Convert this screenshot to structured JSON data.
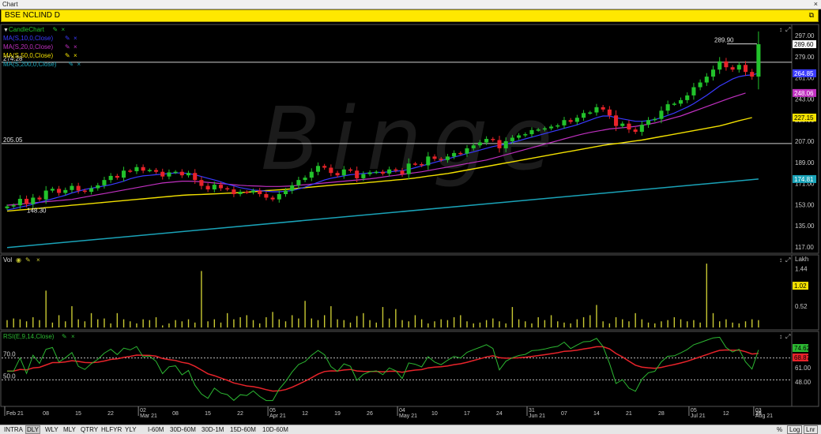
{
  "window": {
    "title": "Chart",
    "close_label": "×"
  },
  "symbol_bar": {
    "symbol": "BSE NCLIND D"
  },
  "watermark": "Binge",
  "legend": {
    "candle": "CandleChart",
    "ma5": "MA(S,10,0,Close)",
    "ma20": "MA(S,20,0,Close)",
    "ma50": "MA(S,50,0,Close)",
    "ma200": "MA(S,200,0,Close)",
    "vol": "Vol",
    "rsi": "RSI(E,9,14,Close)",
    "volume_unit": "Lakh"
  },
  "colors": {
    "up": "#22c22b",
    "down": "#e8232a",
    "ma10": "#3a3aff",
    "ma20": "#c030c0",
    "ma50": "#f2e000",
    "ma200": "#1aa3b8",
    "volume": "#c8c832",
    "rsi_line": "#2cb832",
    "rsi_signal": "#e8232a"
  },
  "bottom_bar": {
    "periods": [
      "INTRA",
      "DLY",
      "WLY",
      "MLY",
      "QTRY",
      "HLFYR",
      "YLY",
      "I-60M",
      "30D-60M",
      "30D-1M",
      "15D-60M",
      "10D-60M"
    ],
    "active_period": "DLY",
    "percent": "%",
    "log": "Log",
    "linear": "Lnr"
  },
  "chart_data": [
    {
      "type": "candlestick",
      "title": "BSE NCLIND D",
      "ylim": [
        117,
        297
      ],
      "y_ticks": [
        "297.00",
        "279.00",
        "261.00",
        "243.00",
        "225.00",
        "207.00",
        "189.00",
        "171.00",
        "153.00",
        "135.00",
        "117.00"
      ],
      "x_ticks": [
        "Feb 21",
        "08",
        "15",
        "22",
        "Mar 21",
        "08",
        "15",
        "22",
        "Apr 21",
        "12",
        "19",
        "26",
        "May 21",
        "10",
        "17",
        "24",
        "Jun 21",
        "07",
        "14",
        "21",
        "28",
        "Jul 21",
        "12",
        "19",
        "26",
        "Aug 21"
      ],
      "x_tick_top": [
        "",
        "",
        "",
        "",
        "02",
        "",
        "",
        "",
        "05",
        "",
        "",
        "",
        "04",
        "",
        "",
        "",
        "31",
        "",
        "",
        "",
        "",
        "05",
        "",
        "",
        "",
        "03"
      ],
      "horizontal_lines": [
        {
          "value": 274.28,
          "label": "274.28"
        },
        {
          "value": 205.05,
          "label": "205.05"
        }
      ],
      "annotations": [
        {
          "text": "289.90",
          "value": 289.9
        },
        {
          "text": "148.30",
          "value": 148.3
        }
      ],
      "last_values": [
        {
          "value": 289.6,
          "label": "289.60",
          "color": "#ffffff"
        },
        {
          "value": 264.85,
          "label": "264.85",
          "color": "#3a3aff"
        },
        {
          "value": 248.06,
          "label": "248.06",
          "color": "#c030c0"
        },
        {
          "value": 227.15,
          "label": "227.15",
          "color": "#f2e000"
        },
        {
          "value": 174.81,
          "label": "174.81",
          "color": "#1aa3b8"
        }
      ],
      "close": [
        151.5,
        152.5,
        158,
        153.5,
        159,
        157.5,
        165,
        166.5,
        163,
        165.5,
        169,
        165,
        164,
        167,
        169.5,
        174,
        177.5,
        176,
        182,
        181.5,
        185,
        182,
        182.5,
        181,
        177,
        180.5,
        181,
        178,
        180,
        174,
        169,
        166,
        170,
        167,
        166,
        162,
        164,
        163.5,
        165,
        162,
        159,
        157.5,
        162,
        165,
        169.5,
        174,
        176,
        181,
        186,
        184.5,
        180,
        178,
        183,
        182,
        175.5,
        179,
        180.5,
        181,
        179.5,
        183,
        182,
        179,
        188,
        187.5,
        186.5,
        194,
        192,
        191,
        194,
        197,
        196.5,
        201,
        203.5,
        206,
        209,
        208,
        201,
        207,
        210,
        212,
        213,
        216.5,
        217,
        218,
        219.5,
        220.5,
        225,
        223.5,
        227,
        231,
        231.5,
        236,
        234,
        229,
        220,
        222,
        217,
        215,
        221,
        225,
        226,
        233,
        238.5,
        239,
        242,
        246,
        253,
        257,
        262,
        268,
        275,
        270,
        268,
        272,
        266,
        262,
        289.6
      ],
      "ma10": [
        148.5,
        149.5,
        151,
        152,
        153.5,
        155,
        156.5,
        158,
        159.5,
        161,
        163,
        164.5,
        166,
        167,
        168,
        169,
        170,
        171.5,
        173,
        175,
        176.5,
        177.5,
        178,
        178.5,
        179,
        179.5,
        180,
        180,
        179.5,
        178.5,
        177,
        175.5,
        174,
        172.5,
        170.5,
        169,
        167.5,
        166.5,
        165.5,
        165,
        164.5,
        164,
        164,
        164.5,
        165,
        166.5,
        168,
        170,
        172,
        174,
        175.5,
        176.5,
        177.5,
        178.5,
        179,
        179.5,
        180,
        180.5,
        180.5,
        181,
        181.5,
        182,
        183,
        184.5,
        186,
        187.5,
        189,
        190.5,
        192,
        193.5,
        195,
        196.5,
        198,
        199.5,
        201,
        202.5,
        203.5,
        204.5,
        206,
        207.5,
        209,
        210.5,
        212,
        213.5,
        215,
        216.5,
        218,
        219.5,
        221,
        223,
        225,
        227,
        228.5,
        228.5,
        227,
        226,
        225,
        224,
        224,
        224.5,
        225.5,
        227,
        229,
        231,
        233.5,
        236,
        239,
        242.5,
        246,
        250,
        254,
        257,
        260,
        262,
        263,
        263.5,
        264.85
      ],
      "ma20": [
        152.5,
        153,
        153.5,
        154,
        154.5,
        155,
        155.5,
        156,
        156.5,
        157,
        157.5,
        158.5,
        159.5,
        160.5,
        161.5,
        162.5,
        163.5,
        164.5,
        165.5,
        166.5,
        167.5,
        168.5,
        169.5,
        170.5,
        171.5,
        172,
        172.5,
        173,
        173,
        172.8,
        172.5,
        172,
        171.5,
        171,
        170.5,
        170,
        169.5,
        169.2,
        169,
        168.8,
        168.5,
        168.5,
        168.5,
        168.7,
        169,
        169.5,
        170,
        170.5,
        171,
        171.5,
        172,
        172.5,
        173,
        173.5,
        174,
        174.5,
        175,
        175.7,
        176.5,
        177.3,
        178,
        178.8,
        179.5,
        180.3,
        181,
        182,
        183,
        184,
        185,
        186,
        187,
        188,
        189,
        190,
        191,
        192.5,
        194,
        195.5,
        197,
        198.5,
        200,
        201.5,
        203,
        204.5,
        206,
        207.5,
        209,
        210.5,
        212,
        213.3,
        214.5,
        215.5,
        216.5,
        217.5,
        218,
        218.5,
        219,
        219.7,
        220.5,
        221.5,
        222.5,
        224,
        225.5,
        227,
        228.5,
        230.5,
        232.5,
        234.5,
        236.5,
        238.5,
        240.5,
        242.5,
        244.5,
        246.2,
        248.06
      ],
      "ma50": [
        147.5,
        148,
        148.5,
        149,
        149.5,
        150,
        150.5,
        151,
        151.5,
        152,
        152.5,
        153,
        153.5,
        154,
        154.5,
        155,
        155.5,
        156,
        156.5,
        157,
        157.5,
        158,
        158.5,
        159,
        159.5,
        160,
        160.5,
        161,
        161.3,
        161.5,
        161.7,
        162,
        162.2,
        162.5,
        162.8,
        163,
        163.3,
        163.6,
        164,
        164.5,
        165,
        165.3,
        165.6,
        166,
        166.5,
        167,
        167.5,
        168,
        168.5,
        169,
        169.5,
        170,
        170.3,
        170.7,
        171,
        171.5,
        172,
        172.5,
        173,
        173.5,
        174,
        174.5,
        175,
        175.7,
        176.5,
        177.3,
        178,
        178.8,
        179.5,
        180.5,
        181.5,
        182.5,
        183.5,
        184.5,
        185.5,
        186.5,
        187.5,
        188.5,
        189.5,
        190.5,
        191.5,
        192.5,
        193.5,
        194.5,
        195.5,
        196.5,
        197.5,
        198.5,
        199.5,
        200.5,
        201.5,
        202.5,
        203.5,
        204.3,
        205,
        205.7,
        206.5,
        207.3,
        208,
        209,
        210,
        211,
        212,
        213,
        214,
        215,
        216,
        217,
        218,
        219,
        220,
        221.5,
        223,
        224.5,
        225.8,
        227.15
      ],
      "ma200": {
        "start": 116.5,
        "end": 174.81
      }
    },
    {
      "type": "bar",
      "title": "Vol",
      "unit": "Lakh",
      "y_ticks": [
        "1.44",
        "0.52"
      ],
      "ylim": [
        0,
        1.6
      ],
      "last_value": "1.02",
      "values": [
        0.18,
        0.22,
        0.2,
        0.15,
        0.25,
        0.18,
        0.9,
        0.12,
        0.3,
        0.15,
        0.52,
        0.2,
        0.15,
        0.35,
        0.2,
        0.22,
        0.1,
        0.35,
        0.2,
        0.15,
        0.1,
        0.2,
        0.18,
        0.25,
        0.05,
        0.1,
        0.18,
        0.15,
        0.2,
        0.12,
        1.38,
        0.15,
        0.2,
        0.12,
        0.35,
        0.2,
        0.25,
        0.3,
        0.18,
        0.1,
        0.25,
        0.38,
        0.2,
        0.15,
        0.3,
        0.22,
        0.65,
        0.22,
        0.18,
        0.3,
        0.52,
        0.2,
        0.18,
        0.12,
        0.28,
        0.35,
        0.18,
        0.12,
        0.5,
        0.22,
        0.45,
        0.18,
        0.15,
        0.3,
        0.2,
        0.1,
        0.15,
        0.2,
        0.18,
        0.25,
        0.3,
        0.15,
        0.1,
        0.12,
        0.18,
        0.22,
        0.15,
        0.1,
        0.5,
        0.2,
        0.15,
        0.1,
        0.25,
        0.18,
        0.3,
        0.15,
        0.12,
        0.1,
        0.2,
        0.25,
        0.3,
        0.55,
        0.15,
        0.1,
        0.25,
        0.2,
        0.15,
        0.35,
        0.2,
        0.12,
        0.1,
        0.15,
        0.18,
        0.25,
        0.2,
        0.15,
        0.18,
        0.12,
        1.56,
        0.35,
        0.15,
        0.2,
        0.12,
        0.1,
        0.15,
        0.2,
        0.18,
        0.1,
        1.02
      ]
    },
    {
      "type": "line",
      "title": "RSI(E,9,14,Close)",
      "ylim": [
        30,
        90
      ],
      "reference_lines": [
        {
          "value": 70,
          "label": "70.0"
        },
        {
          "value": 50,
          "label": "50.0"
        }
      ],
      "y_ticks": [
        "61.00",
        "48.00"
      ],
      "last_values": [
        {
          "label": "74.62",
          "color": "#2cb832"
        },
        {
          "label": "68.87",
          "color": "#e8232a"
        }
      ]
    }
  ]
}
